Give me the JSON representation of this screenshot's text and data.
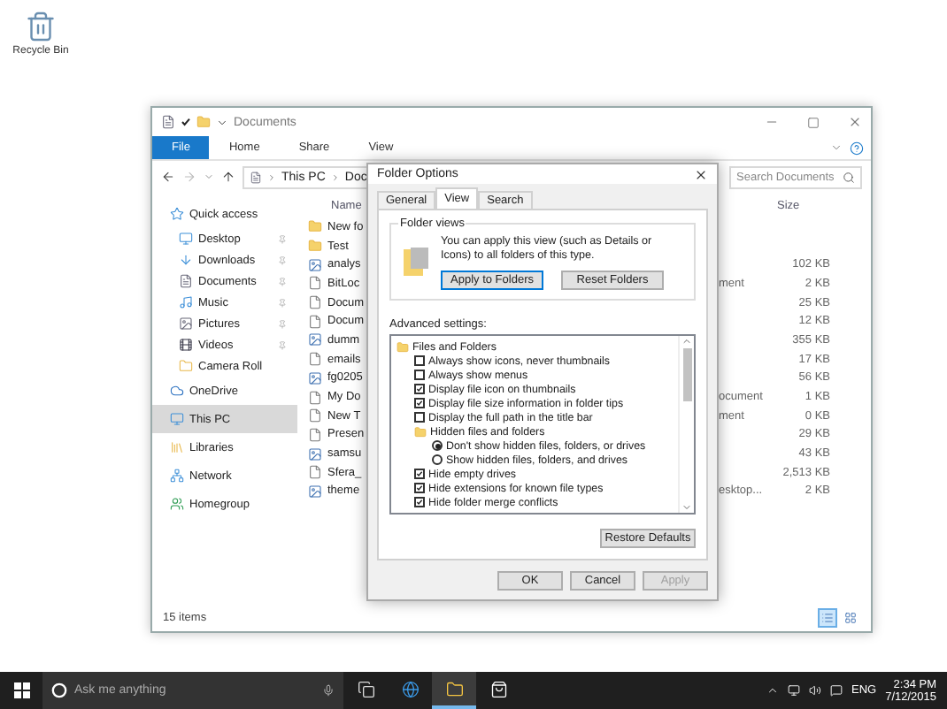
{
  "desktop_icons": [
    {
      "label": "Recycle Bin"
    }
  ],
  "explorer": {
    "title": "Documents",
    "ribbon_tabs": [
      {
        "label": "File",
        "kind": "file"
      },
      {
        "label": "Home",
        "kind": "tab"
      },
      {
        "label": "Share",
        "kind": "tab"
      },
      {
        "label": "View",
        "kind": "tab"
      }
    ],
    "path": [
      "This PC",
      "Doc"
    ],
    "search": {
      "placeholder": "Search Documents"
    },
    "nav": [
      {
        "label": "Quick access",
        "selected": false,
        "pinned": false,
        "group": true
      },
      {
        "label": "Desktop",
        "selected": false,
        "pinned": true
      },
      {
        "label": "Downloads",
        "selected": false,
        "pinned": true
      },
      {
        "label": "Documents",
        "selected": false,
        "pinned": true
      },
      {
        "label": "Music",
        "selected": false,
        "pinned": true
      },
      {
        "label": "Pictures",
        "selected": false,
        "pinned": true
      },
      {
        "label": "Videos",
        "selected": false,
        "pinned": true
      },
      {
        "label": "Camera Roll",
        "selected": false,
        "pinned": false
      },
      {
        "label": "OneDrive",
        "selected": false,
        "pinned": false,
        "group": true
      },
      {
        "label": "This PC",
        "selected": true,
        "pinned": false,
        "group": true
      },
      {
        "label": "Libraries",
        "selected": false,
        "pinned": false,
        "group": true
      },
      {
        "label": "Network",
        "selected": false,
        "pinned": false,
        "group": true
      },
      {
        "label": "Homegroup",
        "selected": false,
        "pinned": false,
        "group": true
      }
    ],
    "columns": [
      {
        "label": "Name"
      },
      {
        "label": "Size"
      }
    ],
    "files": [
      {
        "name": "New fo",
        "kind": "folder"
      },
      {
        "name": "Test",
        "kind": "folder"
      },
      {
        "name": "analys",
        "kind": "image",
        "size": "102 KB"
      },
      {
        "name": "BitLoc",
        "kind": "file",
        "type": "ment",
        "size": "2 KB"
      },
      {
        "name": "Docum",
        "kind": "file",
        "size": "25 KB"
      },
      {
        "name": "Docum",
        "kind": "file",
        "size": "12 KB"
      },
      {
        "name": "dumm",
        "kind": "image",
        "size": "355 KB"
      },
      {
        "name": "emails",
        "kind": "file",
        "size": "17 KB"
      },
      {
        "name": "fg0205",
        "kind": "image",
        "size": "56 KB"
      },
      {
        "name": "My Do",
        "kind": "file",
        "type": "ocument",
        "size": "1 KB"
      },
      {
        "name": "New T",
        "kind": "file",
        "type": "ment",
        "size": "0 KB"
      },
      {
        "name": "Presen",
        "kind": "file",
        "size": "29 KB"
      },
      {
        "name": "samsu",
        "kind": "image",
        "size": "43 KB"
      },
      {
        "name": "Sfera_",
        "kind": "file",
        "size": "2,513 KB"
      },
      {
        "name": "theme",
        "kind": "image",
        "type": "esktop...",
        "size": "2 KB"
      }
    ],
    "status": "15 items",
    "views": [
      {
        "selected": true
      },
      {
        "selected": false
      }
    ]
  },
  "dialog": {
    "title": "Folder Options",
    "tabs": [
      {
        "label": "General",
        "selected": false
      },
      {
        "label": "View",
        "selected": true
      },
      {
        "label": "Search",
        "selected": false
      }
    ],
    "group_title": "Folder views",
    "description": "You can apply this view (such as Details or Icons) to all folders of this type.",
    "group_buttons": [
      {
        "label": "Apply to Folders",
        "focused": true
      },
      {
        "label": "Reset Folders",
        "focused": false
      }
    ],
    "advanced_label": "Advanced settings:",
    "tree": [
      {
        "kind": "folder",
        "label": "Files and Folders",
        "children": [
          {
            "kind": "checkbox",
            "label": "Always show icons, never thumbnails",
            "checked": false
          },
          {
            "kind": "checkbox",
            "label": "Always show menus",
            "checked": false
          },
          {
            "kind": "checkbox",
            "label": "Display file icon on thumbnails",
            "checked": true
          },
          {
            "kind": "checkbox",
            "label": "Display file size information in folder tips",
            "checked": true
          },
          {
            "kind": "checkbox",
            "label": "Display the full path in the title bar",
            "checked": false
          },
          {
            "kind": "folder",
            "label": "Hidden files and folders",
            "children": [
              {
                "kind": "radio",
                "label": "Don't show hidden files, folders, or drives",
                "selected": true
              },
              {
                "kind": "radio",
                "label": "Show hidden files, folders, and drives",
                "selected": false
              }
            ]
          },
          {
            "kind": "checkbox",
            "label": "Hide empty drives",
            "checked": true
          },
          {
            "kind": "checkbox",
            "label": "Hide extensions for known file types",
            "checked": true
          },
          {
            "kind": "checkbox",
            "label": "Hide folder merge conflicts",
            "checked": true
          }
        ]
      }
    ],
    "restore_button": "Restore Defaults",
    "buttons": [
      {
        "label": "OK",
        "disabled": false
      },
      {
        "label": "Cancel",
        "disabled": false
      },
      {
        "label": "Apply",
        "disabled": true
      }
    ]
  },
  "taskbar": {
    "search": {
      "placeholder": "Ask me anything"
    },
    "apps": [
      {
        "selected": false
      },
      {
        "selected": false
      },
      {
        "selected": true
      },
      {
        "selected": false
      }
    ],
    "language": "ENG",
    "time": "2:34 PM",
    "date": "7/12/2015"
  }
}
